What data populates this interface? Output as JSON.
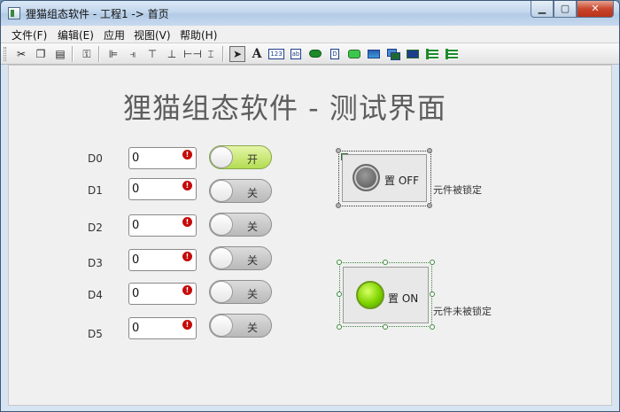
{
  "window": {
    "title": "狸猫组态软件 - 工程1 -> 首页",
    "minimize": "▁",
    "maximize": "▢",
    "close": "✕"
  },
  "menu": [
    "文件(F)",
    "编辑(E)",
    "应用",
    "视图(V)",
    "帮助(H)"
  ],
  "toolbar": {
    "text_tool": "A",
    "num_tool": "123",
    "text_box": "ab",
    "icon_tool": "D"
  },
  "canvas": {
    "title": "狸猫组态软件 - 测试界面",
    "rows": [
      {
        "label": "D0",
        "value": "0",
        "switch": "开",
        "on": true
      },
      {
        "label": "D1",
        "value": "0",
        "switch": "关",
        "on": false
      },
      {
        "label": "D2",
        "value": "0",
        "switch": "关",
        "on": false
      },
      {
        "label": "D3",
        "value": "0",
        "switch": "关",
        "on": false
      },
      {
        "label": "D4",
        "value": "0",
        "switch": "关",
        "on": false
      },
      {
        "label": "D5",
        "value": "0",
        "switch": "关",
        "on": false
      }
    ],
    "error_glyph": "!",
    "button_off": {
      "label": "置 OFF",
      "note": "元件被锁定"
    },
    "button_on": {
      "label": "置 ON",
      "note": "元件未被锁定"
    }
  },
  "colors": {
    "switch_on": "#b3dd52",
    "switch_off": "#c8c8c8",
    "lamp_on": "#7fd400",
    "lamp_off": "#6a6a6a",
    "error": "#c60a0a"
  }
}
